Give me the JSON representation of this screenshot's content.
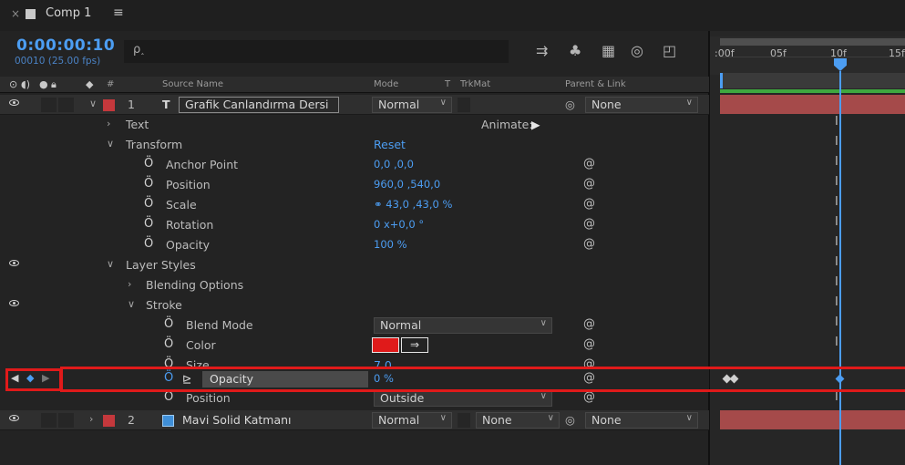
{
  "tab": {
    "close": "×",
    "title": "Comp 1",
    "menu": "≡"
  },
  "timecode": {
    "main": "0:00:00:10",
    "sub": "00010 (25.00 fps)"
  },
  "search": {
    "placeholder": "ρ˰"
  },
  "ruler": {
    "labels": [
      ":00f",
      "05f",
      "10f",
      "15f"
    ]
  },
  "headers": {
    "source_name": "Source Name",
    "mode": "Mode",
    "t": "T",
    "trkmat": "TrkMat",
    "parent": "Parent & Link",
    "hash": "#"
  },
  "layer1": {
    "index": "1",
    "type_icon": "T",
    "name": "Grafik Canlandırma Dersi",
    "mode": "Normal",
    "parent": "None",
    "label_color": "#c4383c"
  },
  "props": {
    "text": "Text",
    "animate": "Animate:",
    "transform": "Transform",
    "reset": "Reset",
    "anchor": "Anchor Point",
    "anchor_val": "0,0 ,0,0",
    "position": "Position",
    "position_val": "960,0 ,540,0",
    "scale": "Scale",
    "scale_val": "⚭ 43,0 ,43,0 %",
    "rotation": "Rotation",
    "rotation_val": "0 x+0,0 °",
    "opacity": "Opacity",
    "opacity_val": "100 %",
    "layer_styles": "Layer Styles",
    "blending": "Blending Options",
    "stroke": "Stroke",
    "blend_mode": "Blend Mode",
    "blend_mode_val": "Normal",
    "color": "Color",
    "color_swatch": "#e01a1a",
    "size": "Size",
    "size_val": "7,0",
    "stroke_opacity": "Opacity",
    "stroke_opacity_val": "0 %",
    "stroke_position": "Position",
    "stroke_position_val": "Outside"
  },
  "layer2": {
    "index": "2",
    "name": "Mavi Solid Katmanı",
    "mode": "Normal",
    "trkmat": "None",
    "parent": "None",
    "label_color": "#c4383c",
    "swatch": "#3f8fd8"
  }
}
